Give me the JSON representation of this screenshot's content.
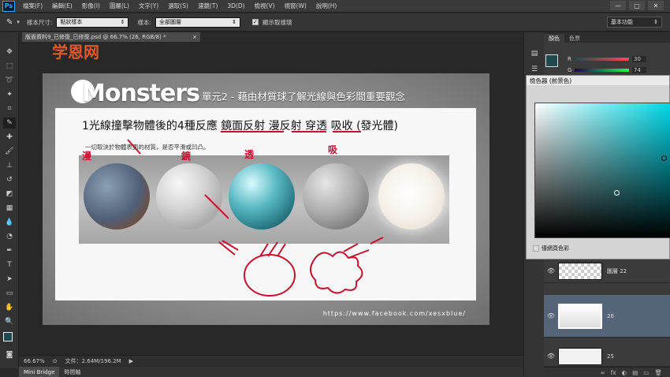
{
  "app": {
    "logo": "Ps",
    "menus": [
      "檔案(F)",
      "編輯(E)",
      "影像(I)",
      "圖層(L)",
      "文字(Y)",
      "選取(S)",
      "濾鏡(T)",
      "3D(D)",
      "檢視(V)",
      "視窗(W)",
      "說明(H)"
    ],
    "window_buttons": [
      "—",
      "▢",
      "✕"
    ]
  },
  "options": {
    "sample_size_label": "樣本尺寸:",
    "sample_size_value": "點狀樣本",
    "sample_label": "樣本:",
    "sample_value": "全部圖層",
    "show_ring_label": "顯示取樣環",
    "workspace_label": "基本功能"
  },
  "document": {
    "tab_title": "版面資料9_已修復_已修復.psd @ 66.7% (26, RGB/8) *",
    "tab_close": "×",
    "watermark": "学恩网",
    "artwork": {
      "brand": "Monsters",
      "lesson_title": "單元2 - 藉由材質球了解光線與色彩間重要觀念",
      "heading": "1光線撞擊物體後的4種反應 鏡面反射 漫反射 穿透 吸收 (發光體)",
      "subtext": "一切取決於物體表面的材質，是否平滑或凹凸。",
      "url": "https://www.facebook.com/xesxblue/",
      "annotations": [
        "漫",
        "鏡",
        "透",
        "吸"
      ]
    }
  },
  "status": {
    "zoom": "66.67%",
    "file_info": "文件：2.64M/196.2M"
  },
  "bottom_tabs": [
    "Mini Bridge",
    "時間軸"
  ],
  "panels": {
    "color_tabs": [
      "顏色",
      "色票"
    ],
    "channels": [
      "R",
      "G"
    ],
    "values": [
      "30",
      "74"
    ],
    "color_picker_title": "檢色器 (前景色)",
    "only_web_colors": "僅網頁色彩",
    "layers": [
      {
        "name": "圖層 22"
      },
      {
        "name": "26"
      },
      {
        "name": "25"
      }
    ],
    "footer_icons": [
      "∞",
      "fx",
      "◐",
      "▤",
      "▭",
      "🗑"
    ]
  },
  "colors": {
    "foreground": "#1e4a4f",
    "accent_red": "#c8102e"
  }
}
